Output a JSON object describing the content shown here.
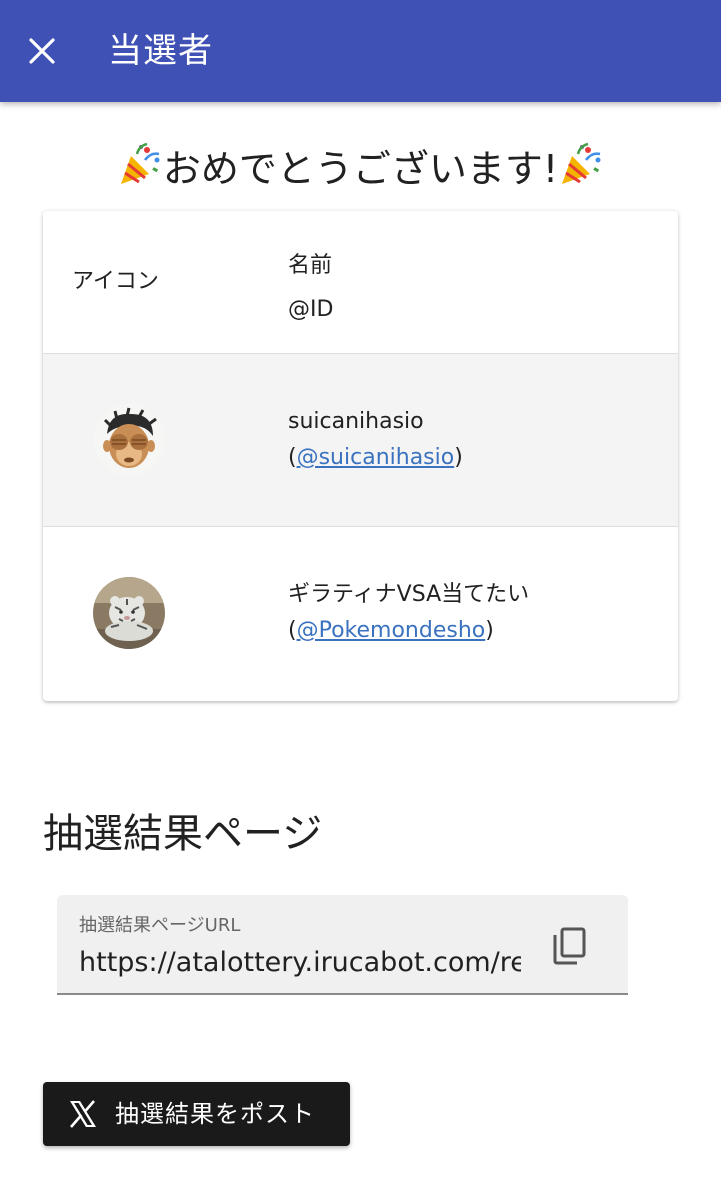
{
  "appbar": {
    "title": "当選者",
    "close_icon": "close-icon"
  },
  "congrats": {
    "text": "おめでとうございます!",
    "icon": "party-popper-icon"
  },
  "table": {
    "header": {
      "icon_col": "アイコン",
      "name_col": "名前",
      "id_col": "@ID"
    },
    "rows": [
      {
        "name": "suicanihasio",
        "id_prefix": "(",
        "id": "@suicanihasio",
        "id_suffix": ")",
        "avatar": "avatar-monkey"
      },
      {
        "name": "ギラティナVSA当てたい",
        "id_prefix": "(",
        "id": "@Pokemondesho",
        "id_suffix": ")",
        "avatar": "avatar-white-tiger"
      }
    ]
  },
  "result_page": {
    "title": "抽選結果ページ",
    "url_label": "抽選結果ページURL",
    "url_value": "https://atalottery.irucabot.com/res",
    "copy_icon": "copy-icon"
  },
  "post_button": {
    "label": "抽選結果をポスト",
    "icon": "x-logo-icon"
  },
  "colors": {
    "appbar": "#3f51b5",
    "link": "#3a72c0",
    "post_button": "#1a1a1a"
  }
}
